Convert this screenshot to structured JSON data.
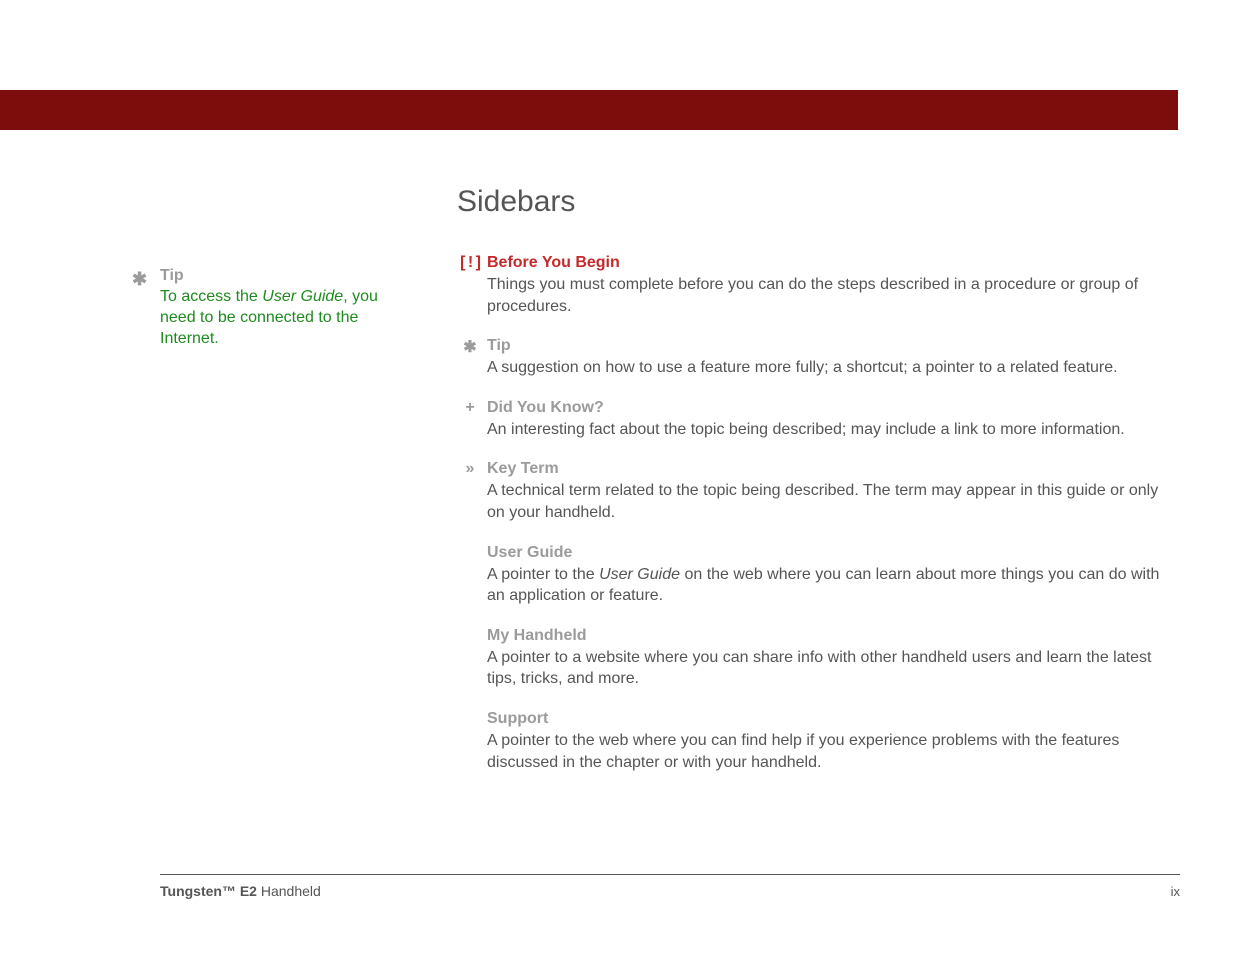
{
  "sidebar_tip": {
    "label": "Tip",
    "body_prefix": "To access the ",
    "body_em": "User Guide",
    "body_suffix": ", you need to be connected to the Internet."
  },
  "heading": "Sidebars",
  "items": [
    {
      "icon": "[ ! ]",
      "icon_class": "byb-icon",
      "title": "Before You Begin",
      "title_class": "byb-title",
      "body": "Things you must complete before you can do the steps described in a procedure or group of procedures."
    },
    {
      "icon": "✱",
      "icon_class": "gray-icon",
      "title": "Tip",
      "title_class": "gray-title",
      "body": "A suggestion on how to use a feature more fully; a shortcut; a pointer to a related feature."
    },
    {
      "icon": "+",
      "icon_class": "gray-icon",
      "title": "Did You Know?",
      "title_class": "gray-title",
      "body": "An interesting fact about the topic being described; may include a link to more information."
    },
    {
      "icon": "»",
      "icon_class": "gray-icon",
      "title": "Key Term",
      "title_class": "gray-title",
      "body": "A technical term related to the topic being described. The term may appear in this guide or only on your handheld."
    },
    {
      "icon": "",
      "icon_class": "",
      "title": "User Guide",
      "title_class": "gray-title",
      "body_prefix": "A pointer to the ",
      "body_em": "User Guide",
      "body_suffix": " on the web where you can learn about more things you can do with an application or feature."
    },
    {
      "icon": "",
      "icon_class": "",
      "title": "My Handheld",
      "title_class": "gray-title",
      "body": "A pointer to a website where you can share info with other handheld users and learn the latest tips, tricks, and more."
    },
    {
      "icon": "",
      "icon_class": "",
      "title": "Support",
      "title_class": "gray-title",
      "body": "A pointer to the web where you can find help if you experience problems with the features discussed in the chapter or with your handheld."
    }
  ],
  "footer": {
    "product_bold": "Tungsten™ E2",
    "product_rest": " Handheld",
    "page": "ix"
  }
}
